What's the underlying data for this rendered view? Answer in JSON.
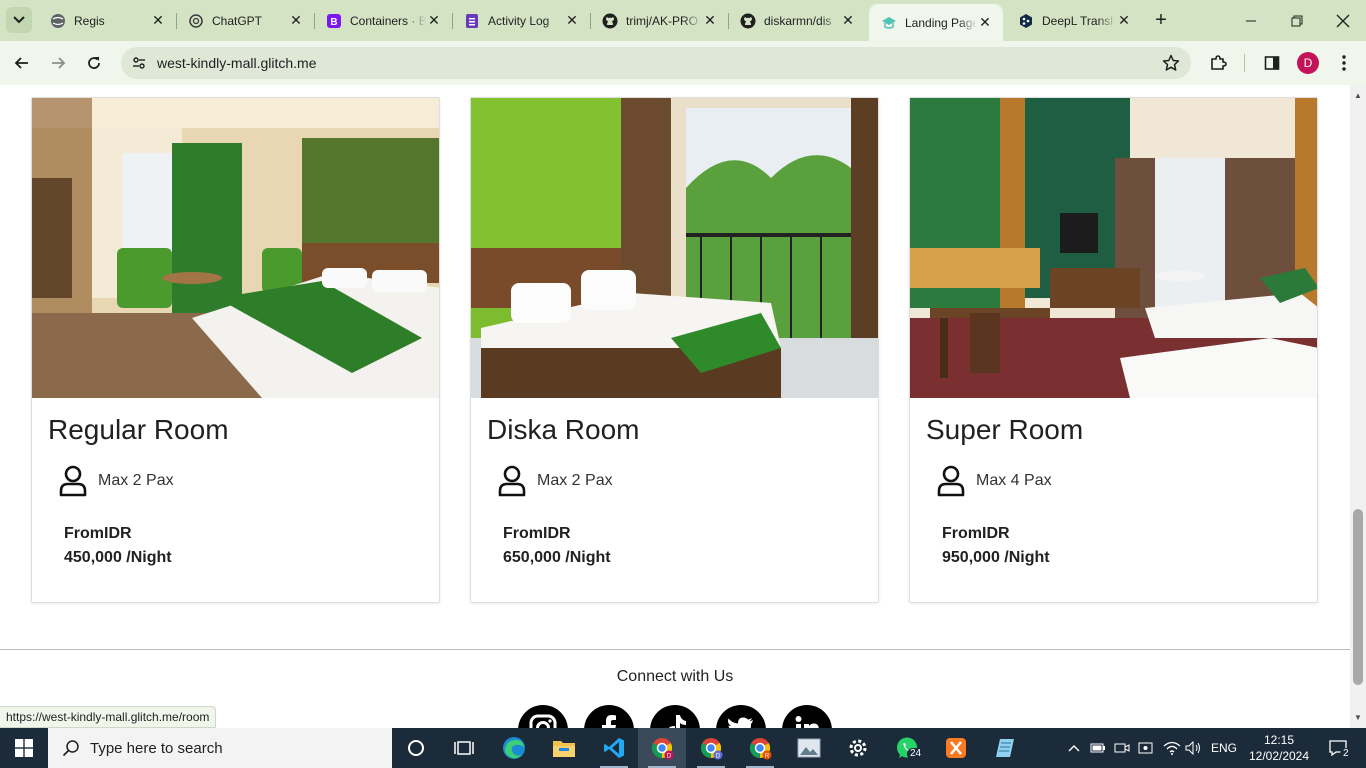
{
  "browser": {
    "tabs": [
      {
        "title": "Regis",
        "icon": "globe-icon"
      },
      {
        "title": "ChatGPT",
        "icon": "chatgpt-icon"
      },
      {
        "title": "Containers · B",
        "icon": "bootstrap-icon"
      },
      {
        "title": "Activity Log",
        "icon": "forms-icon"
      },
      {
        "title": "trimj/AK-PRO",
        "icon": "github-icon"
      },
      {
        "title": "diskarmn/dis",
        "icon": "github-icon"
      },
      {
        "title": "Landing Page",
        "icon": "landing-icon"
      },
      {
        "title": "DeepL Transl",
        "icon": "deepl-icon"
      }
    ],
    "active_tab_index": 6,
    "url": "west-kindly-mall.glitch.me",
    "profile_initial": "D",
    "status_url": "https://west-kindly-mall.glitch.me/room",
    "colors": {
      "tabstrip": "#d3e3c4",
      "toolbar": "#f1f6ec",
      "profile": "#c5135a"
    }
  },
  "page": {
    "rooms": [
      {
        "name": "Regular Room",
        "pax": "Max 2 Pax",
        "from": "FromIDR",
        "price": "450,000 /Night"
      },
      {
        "name": "Diska Room",
        "pax": "Max 2 Pax",
        "from": "FromIDR",
        "price": "650,000 /Night"
      },
      {
        "name": "Super Room",
        "pax": "Max 4 Pax",
        "from": "FromIDR",
        "price": "950,000 /Night"
      }
    ],
    "connect_heading": "Connect with Us",
    "social": [
      "instagram-icon",
      "facebook-icon",
      "tiktok-icon",
      "twitter-icon",
      "linkedin-icon"
    ]
  },
  "taskbar": {
    "search_placeholder": "Type here to search",
    "language": "ENG",
    "time": "12:15",
    "date": "12/02/2024",
    "whatsapp_badge": "24",
    "notification_count": "2"
  }
}
